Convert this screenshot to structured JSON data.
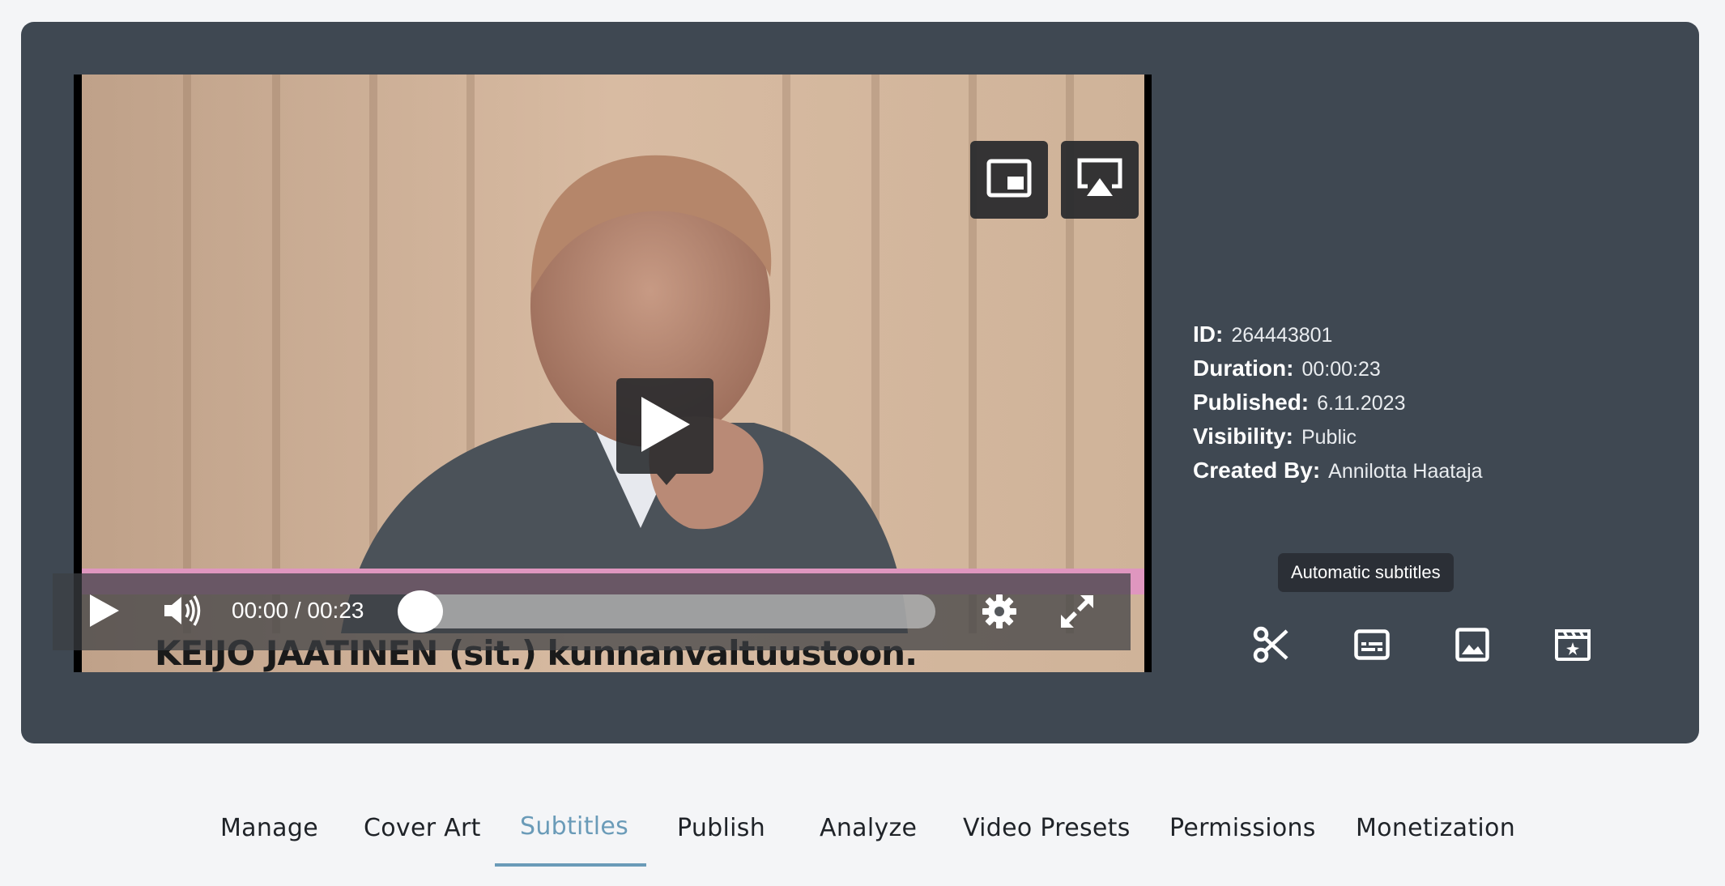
{
  "video": {
    "caption_text": "KEIJO JAATINEN (sit.) kunnanvaltuustoon.",
    "time_display": "00:00 / 00:23",
    "progress": 0.0
  },
  "player_controls": {
    "icons": [
      "picture-in-picture-icon",
      "airplay-icon",
      "play-icon",
      "volume-icon",
      "gear-icon",
      "fullscreen-icon"
    ]
  },
  "meta": {
    "id_label": "ID:",
    "id_value": "264443801",
    "duration_label": "Duration:",
    "duration_value": "00:00:23",
    "published_label": "Published:",
    "published_value": "6.11.2023",
    "visibility_label": "Visibility:",
    "visibility_value": "Public",
    "created_label": "Created By:",
    "created_value": "Annilotta Haataja"
  },
  "tooltip": {
    "text": "Automatic subtitles"
  },
  "tools": [
    "scissors-icon",
    "subtitles-icon",
    "image-icon",
    "clapperboard-icon"
  ],
  "tabs": {
    "manage": "Manage",
    "cover_art": "Cover Art",
    "subtitles": "Subtitles",
    "publish": "Publish",
    "analyze": "Analyze",
    "video_presets": "Video Presets",
    "permissions": "Permissions",
    "monetization": "Monetization",
    "active": "Subtitles"
  },
  "colors": {
    "card_bg": "#3f4852",
    "page_bg": "#f4f5f7",
    "active_tab": "#6a9bb8",
    "subtitle_band": "#df96bf"
  }
}
